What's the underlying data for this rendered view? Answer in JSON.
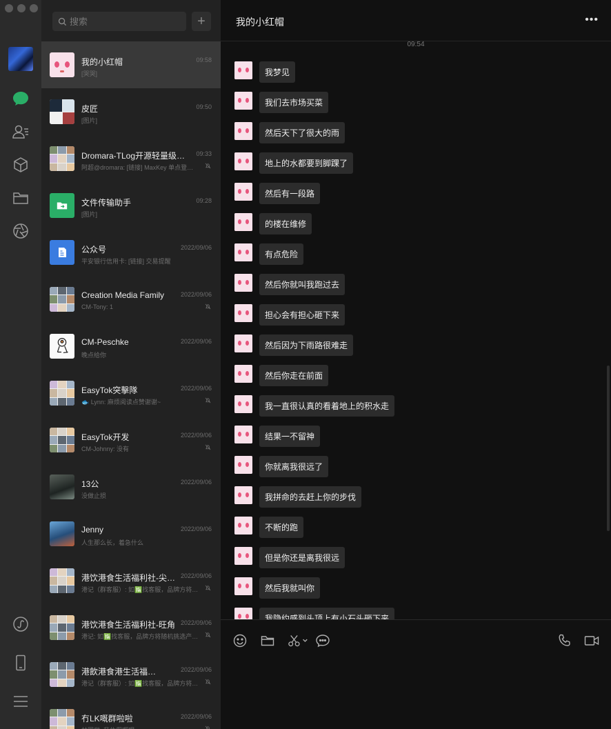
{
  "app": {
    "rail": {
      "items": [
        "chats",
        "contacts",
        "favorites",
        "files",
        "moments",
        "mini-programs",
        "phone",
        "menu"
      ]
    },
    "search": {
      "placeholder": "搜索",
      "add_label": "+"
    },
    "conversations": [
      {
        "name": "我的小红帽",
        "time": "09:58",
        "preview": "[哭哭]",
        "muted": false,
        "avatar": "pink-face"
      },
      {
        "name": "皮匠",
        "time": "09:50",
        "preview": "[图片]",
        "muted": false,
        "avatar": "quad"
      },
      {
        "name": "Dromara-TLog开源轻量级日…",
        "time": "09:33",
        "preview": "阿超@dromara: [链接] MaxKey 单点登…",
        "muted": true,
        "avatar": "grid"
      },
      {
        "name": "文件传输助手",
        "time": "09:28",
        "preview": "[图片]",
        "muted": false,
        "avatar": "file-helper"
      },
      {
        "name": "公众号",
        "time": "2022/09/06",
        "preview": "平安银行信用卡: [链接] 交易提醒",
        "muted": false,
        "avatar": "official"
      },
      {
        "name": "Creation Media Family",
        "time": "2022/09/06",
        "preview": "CM-Tony: 1",
        "muted": true,
        "avatar": "grid"
      },
      {
        "name": "CM-Peschke",
        "time": "2022/09/06",
        "preview": "晚点给你",
        "muted": false,
        "avatar": "sketch"
      },
      {
        "name": "EasyTok突擊隊",
        "time": "2022/09/06",
        "preview": "🐟 Lynn: 麻烦阅读点赞谢谢~",
        "muted": true,
        "avatar": "grid"
      },
      {
        "name": "EasyTok开发",
        "time": "2022/09/06",
        "preview": "CM-Johnny: 没有",
        "muted": true,
        "avatar": "grid"
      },
      {
        "name": "13公",
        "time": "2022/09/06",
        "preview": "没做止损",
        "muted": false,
        "avatar": "photo-dark"
      },
      {
        "name": "Jenny",
        "time": "2022/09/06",
        "preview": "人生那么长，着急什么",
        "muted": false,
        "avatar": "photo-blue"
      },
      {
        "name": "港饮港食生活福利社-尖…",
        "time": "2022/09/06",
        "preview": "港记（群客服）: 如🈯找客服，品牌方将…",
        "muted": true,
        "avatar": "grid"
      },
      {
        "name": "港饮港食生活福利社-旺角",
        "time": "2022/09/06",
        "preview": "港记: 如🈯找客服，品牌方将随机挑选产…",
        "muted": true,
        "avatar": "grid"
      },
      {
        "name": "港飲港食港生活福…",
        "time": "2022/09/06",
        "preview": "港记（群客服）: 如🈯找客服，品牌方将…",
        "muted": true,
        "avatar": "grid"
      },
      {
        "name": "冇LK嘅群啦啦",
        "time": "2022/09/06",
        "preview": "林同学: 我休假嘅呢",
        "muted": true,
        "avatar": "grid"
      }
    ],
    "chat": {
      "title": "我的小红帽",
      "more_label": "•••",
      "timestamp": "09:54",
      "messages": [
        "我梦见",
        "我们去市场买菜",
        "然后天下了很大的雨",
        "地上的水都要到脚踝了",
        "然后有一段路",
        "的楼在维修",
        "有点危险",
        "然后你就叫我跑过去",
        "担心会有担心砸下来",
        "然后因为下雨路很难走",
        "然后你走在前面",
        "我一直很认真的看着地上的积水走",
        "结果一不留神",
        "你就离我很远了",
        "我拼命的去赶上你的步伐",
        "不断的跑",
        "但是你还是离我很远",
        "然后我就叫你",
        "我隐约感到头顶上有小石头砸下来"
      ]
    },
    "composer": {
      "tools": [
        "emoji-icon",
        "folder-icon",
        "scissors-icon",
        "chat-bubble-icon",
        "phone-icon",
        "video-icon"
      ]
    },
    "colors": {
      "accent": "#2AAE67",
      "rail_bg": "#2b2b2b",
      "list_bg": "#222222",
      "chat_bg": "#111111",
      "bubble": "#2c2c2c"
    }
  }
}
